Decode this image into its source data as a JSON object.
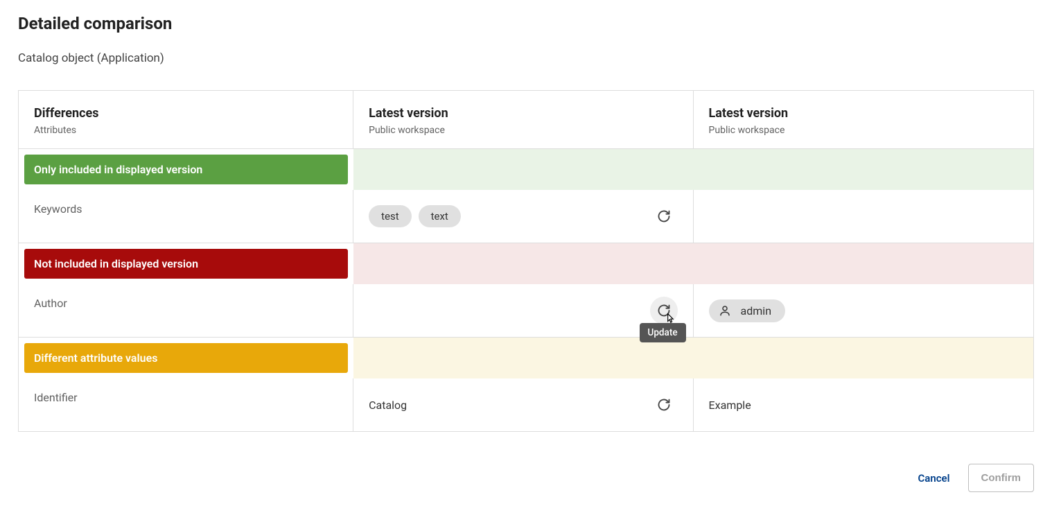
{
  "title": "Detailed comparison",
  "subtitle": "Catalog object (Application)",
  "columns": {
    "c1": {
      "title": "Differences",
      "sub": "Attributes"
    },
    "c2": {
      "title": "Latest version",
      "sub": "Public workspace"
    },
    "c3": {
      "title": "Latest version",
      "sub": "Public workspace"
    }
  },
  "sections": {
    "only_included": "Only included in displayed version",
    "not_included": "Not included in displayed version",
    "different": "Different attribute values"
  },
  "rows": {
    "keywords": {
      "label": "Keywords",
      "chips": [
        "test",
        "text"
      ]
    },
    "author": {
      "label": "Author",
      "user": "admin"
    },
    "identifier": {
      "label": "Identifier",
      "left": "Catalog",
      "right": "Example"
    }
  },
  "tooltip": "Update",
  "footer": {
    "cancel": "Cancel",
    "confirm": "Confirm"
  }
}
